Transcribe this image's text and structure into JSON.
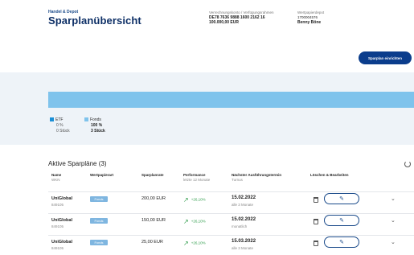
{
  "header": {
    "breadcrumb": "Handel & Depot",
    "title": "Sparplanübersicht",
    "account_label": "Verrechnungskonto / Verfügungsrahmen",
    "account_iban": "DE78 7636 9888 1600 2162 16",
    "account_amount": "100.000,00 EUR",
    "owner_label": "Wertpapierdepot",
    "owner_number": "1700004576",
    "owner_name": "Benny Böne",
    "new_plan_button": "Sparplan einrichten"
  },
  "allocation": {
    "items": [
      {
        "label": "ETF",
        "percent": "0 %",
        "count": "0 Stück",
        "color": "#1a8fd6"
      },
      {
        "label": "Fonds",
        "percent": "100 %",
        "count": "3 Stück",
        "color": "#7fc3ec"
      }
    ]
  },
  "plans": {
    "title": "Aktive Sparpläne (3)",
    "columns": {
      "name": "Name",
      "name_sub": "WKN",
      "type": "Wertpapierart",
      "rate": "Sparplanrate",
      "perf": "Performance",
      "perf_sub": "letzte 12 Monate",
      "next": "Nächster Ausführungstermin",
      "next_sub": "Turnus",
      "actions": "Löschen & Bearbeiten"
    },
    "rows": [
      {
        "name": "UniGlobal",
        "wkn": "849105",
        "type": "Fonds",
        "rate": "200,00 EUR",
        "perf": "+26,10%",
        "date": "15.02.2022",
        "freq": "alle 3 Monate"
      },
      {
        "name": "UniGlobal",
        "wkn": "849105",
        "type": "Fonds",
        "rate": "150,00 EUR",
        "perf": "+26,10%",
        "date": "15.02.2022",
        "freq": "monatlich"
      },
      {
        "name": "UniGlobal",
        "wkn": "849105",
        "type": "Fonds",
        "rate": "25,00 EUR",
        "perf": "+26,10%",
        "date": "15.03.2022",
        "freq": "alle 3 Monate"
      }
    ]
  }
}
